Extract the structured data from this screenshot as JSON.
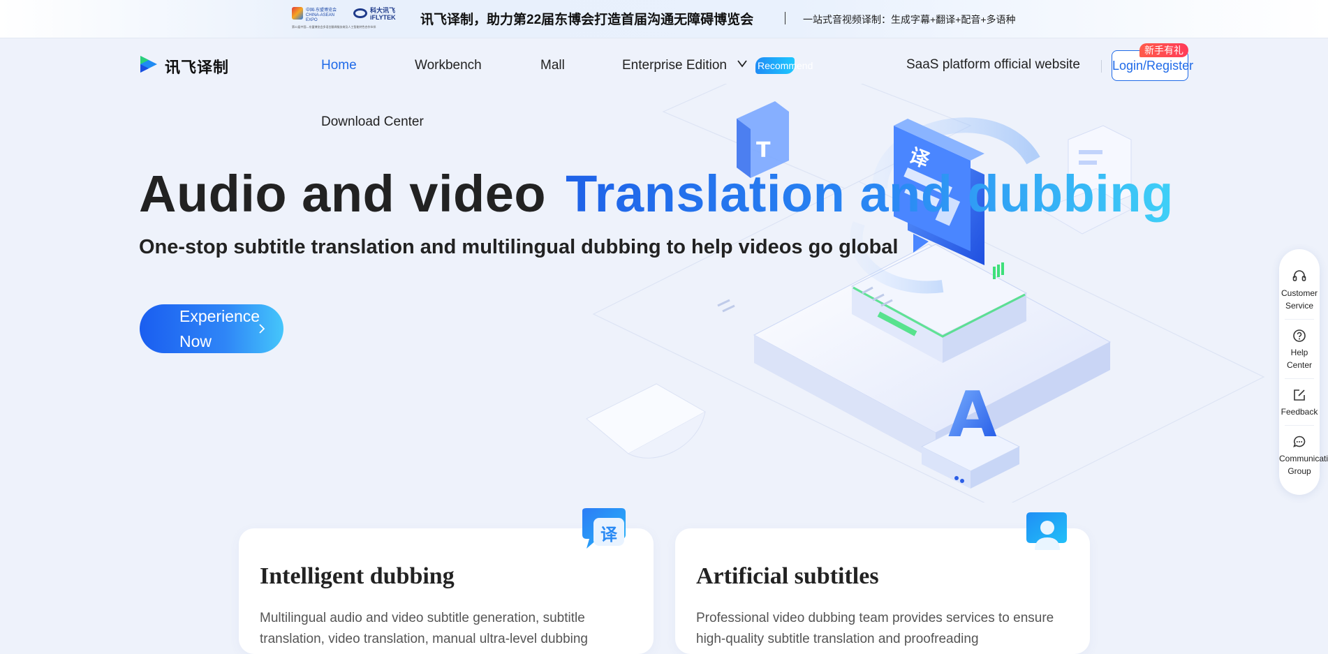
{
  "banner": {
    "logo_a_text": "中国-东盟博览会 CHINA-ASEAN EXPO",
    "logo_b_text": "科大讯飞 iFLYTEK",
    "fine_print": "第22届中国—东盟博览会多语言翻译服务商及人工智能特色合作伙伴",
    "headline": "讯飞译制，助力第22届东博会打造首届沟通无障碍博览会",
    "sub": "一站式音视频译制：生成字幕+翻译+配音+多语种"
  },
  "logo": {
    "text": "讯飞译制"
  },
  "nav": {
    "home": "Home",
    "workbench": "Workbench",
    "mall": "Mall",
    "enterprise": "Enterprise Edition",
    "recommend_badge": "Recommend",
    "download": "Download Center",
    "saas": "SaaS platform official website",
    "login": "Login/Register",
    "gift_badge": "新手有礼"
  },
  "hero": {
    "title_plain": "Audio and video",
    "title_highlight": "Translation and dubbing",
    "subtitle": "One-stop subtitle translation and multilingual dubbing to help videos go global",
    "cta_label": "Experience Now"
  },
  "float_bar": {
    "items": [
      {
        "label": "Customer Service",
        "icon": "headset-icon"
      },
      {
        "label": "Help Center",
        "icon": "question-circle-icon"
      },
      {
        "label": "Feedback",
        "icon": "edit-icon"
      },
      {
        "label": "Communication Group",
        "icon": "chat-bubble-icon"
      }
    ]
  },
  "cards": [
    {
      "title": "Intelligent dubbing",
      "desc_line1": "Multilingual audio and video subtitle generation, subtitle",
      "desc_line2": "translation, video translation, manual ultra-level dubbing",
      "icon": "translate-bubble-icon",
      "icon_glyph": "译"
    },
    {
      "title": "Artificial subtitles",
      "desc_line1": "Professional video dubbing team provides services to ensure",
      "desc_line2": "high-quality subtitle translation and proofreading",
      "icon": "person-chat-icon"
    }
  ],
  "art": {
    "glyph_ze": "译",
    "glyph_a": "A",
    "glyph_t": "T"
  },
  "colors": {
    "accent": "#1f6ae8",
    "cta_end": "#45c6fb",
    "gift": "#ff3b58"
  }
}
